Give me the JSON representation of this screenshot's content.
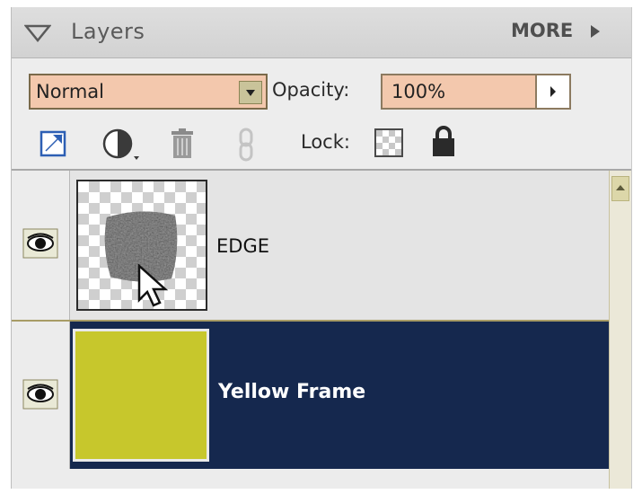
{
  "panel": {
    "title": "Layers",
    "more_label": "MORE",
    "blend_mode": "Normal",
    "opacity_label": "Opacity:",
    "opacity_value": "100%",
    "lock_label": "Lock:"
  },
  "toolbar_icons": [
    "new-layer-icon",
    "adjustment-layer-icon",
    "trash-icon",
    "link-icon",
    "lock-transparency-icon",
    "lock-icon"
  ],
  "layers": [
    {
      "name": "EDGE",
      "visible": true,
      "selected": false
    },
    {
      "name": "Yellow Frame",
      "visible": true,
      "selected": true,
      "fill_color": "#c7c72c"
    }
  ],
  "colors": {
    "selected_row": "#15284e",
    "field_bg": "#f3c8ad"
  }
}
